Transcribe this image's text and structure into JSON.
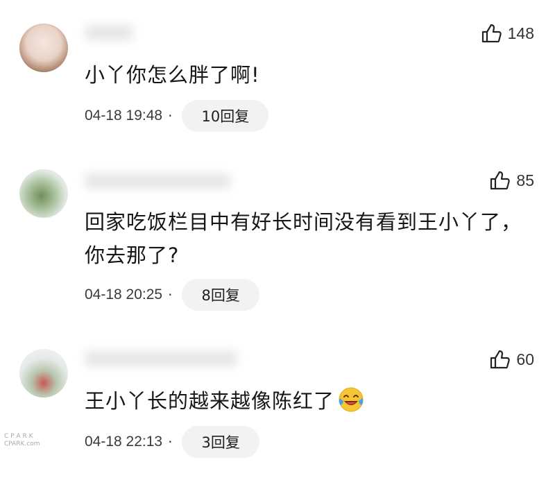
{
  "comments": [
    {
      "likes": "148",
      "text": "小丫你怎么胖了啊!",
      "time": "04-18 19:48",
      "separator": "·",
      "reply_label": "10回复"
    },
    {
      "likes": "85",
      "text": "回家吃饭栏目中有好长时间没有看到王小丫了，你去那了?",
      "time": "04-18 20:25",
      "separator": "·",
      "reply_label": "8回复"
    },
    {
      "likes": "60",
      "text": "王小丫长的越来越像陈红了",
      "emoji": "laughing-crying-emoji",
      "time": "04-18 22:13",
      "separator": "·",
      "reply_label": "3回复"
    }
  ],
  "icons": {
    "like": "thumbs-up-outline-icon"
  },
  "watermark": {
    "line1": "C P A R K",
    "line2": "CPARK.com"
  }
}
